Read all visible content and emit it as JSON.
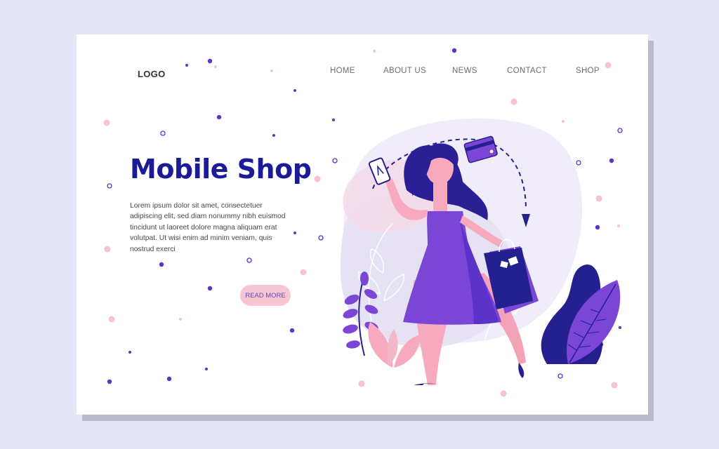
{
  "header": {
    "logo": "LOGO",
    "nav": [
      {
        "label": "HOME"
      },
      {
        "label": "ABOUT US"
      },
      {
        "label": "NEWS"
      },
      {
        "label": "CONTACT"
      },
      {
        "label": "SHOP"
      }
    ]
  },
  "hero": {
    "title": "Mobile Shop",
    "description": "Lorem ipsum dolor sit amet, consectetuer adipiscing elit, sed diam nonummy nibh euismod tincidunt ut laoreet dolore magna aliquam erat volutpat. Ut wisi enim ad minim veniam, quis nostrud exerci",
    "cta_label": "READ MORE"
  },
  "colors": {
    "background": "#e5e6f7",
    "title": "#1b1a99",
    "purple": "#7b46d6",
    "navy": "#24208f",
    "pink": "#f8c6d3",
    "lilac": "#e9e3f7"
  },
  "icons": [
    "smartphone-icon",
    "credit-card-icon",
    "shopping-bag-icon",
    "leaf-icon"
  ]
}
